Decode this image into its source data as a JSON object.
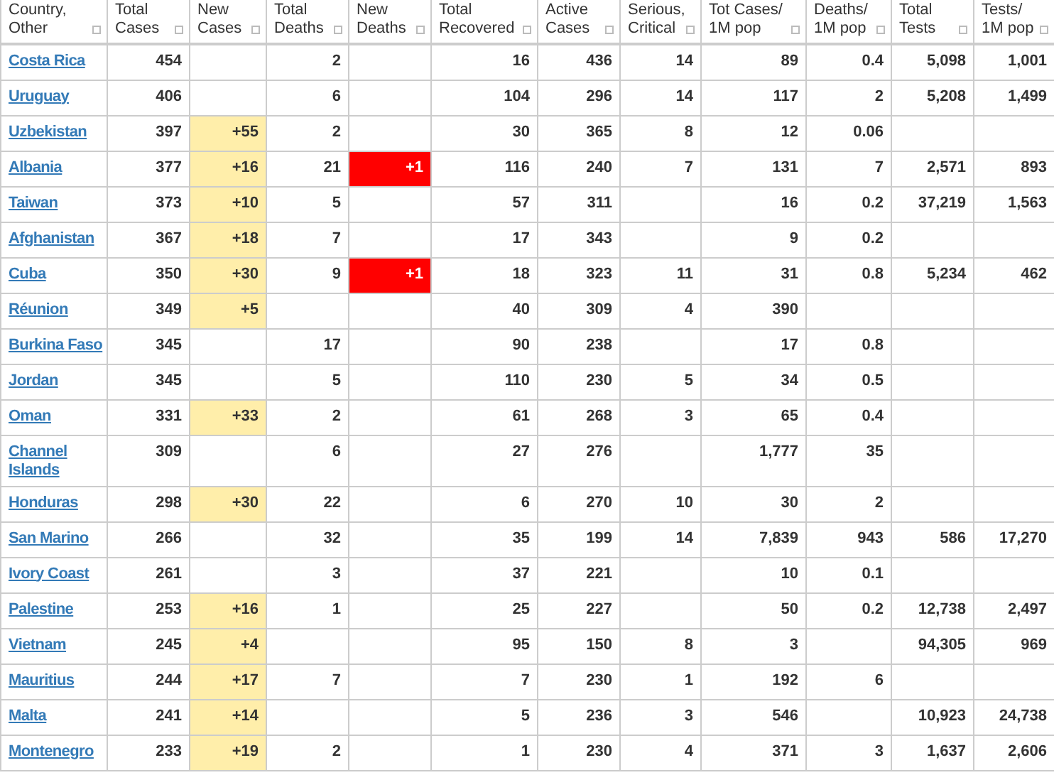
{
  "table": {
    "columns": [
      {
        "label": "Country, Other",
        "kind": "country"
      },
      {
        "label": "Total Cases",
        "kind": "number"
      },
      {
        "label": "New Cases",
        "kind": "new_cases"
      },
      {
        "label": "Total Deaths",
        "kind": "number"
      },
      {
        "label": "New Deaths",
        "kind": "new_deaths"
      },
      {
        "label": "Total Recovered",
        "kind": "number"
      },
      {
        "label": "Active Cases",
        "kind": "number"
      },
      {
        "label": "Serious, Critical",
        "kind": "number"
      },
      {
        "label": "Tot Cases/ 1M pop",
        "kind": "number"
      },
      {
        "label": "Deaths/ 1M pop",
        "kind": "number"
      },
      {
        "label": "Total Tests",
        "kind": "number"
      },
      {
        "label": "Tests/ 1M pop",
        "kind": "number"
      }
    ],
    "rows": [
      [
        "Costa Rica",
        "454",
        null,
        "2",
        null,
        "16",
        "436",
        "14",
        "89",
        "0.4",
        "5,098",
        "1,001"
      ],
      [
        "Uruguay",
        "406",
        null,
        "6",
        null,
        "104",
        "296",
        "14",
        "117",
        "2",
        "5,208",
        "1,499"
      ],
      [
        "Uzbekistan",
        "397",
        "+55",
        "2",
        null,
        "30",
        "365",
        "8",
        "12",
        "0.06",
        null,
        null
      ],
      [
        "Albania",
        "377",
        "+16",
        "21",
        "+1",
        "116",
        "240",
        "7",
        "131",
        "7",
        "2,571",
        "893"
      ],
      [
        "Taiwan",
        "373",
        "+10",
        "5",
        null,
        "57",
        "311",
        null,
        "16",
        "0.2",
        "37,219",
        "1,563"
      ],
      [
        "Afghanistan",
        "367",
        "+18",
        "7",
        null,
        "17",
        "343",
        null,
        "9",
        "0.2",
        null,
        null
      ],
      [
        "Cuba",
        "350",
        "+30",
        "9",
        "+1",
        "18",
        "323",
        "11",
        "31",
        "0.8",
        "5,234",
        "462"
      ],
      [
        "Réunion",
        "349",
        "+5",
        null,
        null,
        "40",
        "309",
        "4",
        "390",
        null,
        null,
        null
      ],
      [
        "Burkina Faso",
        "345",
        null,
        "17",
        null,
        "90",
        "238",
        null,
        "17",
        "0.8",
        null,
        null
      ],
      [
        "Jordan",
        "345",
        null,
        "5",
        null,
        "110",
        "230",
        "5",
        "34",
        "0.5",
        null,
        null
      ],
      [
        "Oman",
        "331",
        "+33",
        "2",
        null,
        "61",
        "268",
        "3",
        "65",
        "0.4",
        null,
        null
      ],
      [
        "Channel Islands",
        "309",
        null,
        "6",
        null,
        "27",
        "276",
        null,
        "1,777",
        "35",
        null,
        null
      ],
      [
        "Honduras",
        "298",
        "+30",
        "22",
        null,
        "6",
        "270",
        "10",
        "30",
        "2",
        null,
        null
      ],
      [
        "San Marino",
        "266",
        null,
        "32",
        null,
        "35",
        "199",
        "14",
        "7,839",
        "943",
        "586",
        "17,270"
      ],
      [
        "Ivory Coast",
        "261",
        null,
        "3",
        null,
        "37",
        "221",
        null,
        "10",
        "0.1",
        null,
        null
      ],
      [
        "Palestine",
        "253",
        "+16",
        "1",
        null,
        "25",
        "227",
        null,
        "50",
        "0.2",
        "12,738",
        "2,497"
      ],
      [
        "Vietnam",
        "245",
        "+4",
        null,
        null,
        "95",
        "150",
        "8",
        "3",
        null,
        "94,305",
        "969"
      ],
      [
        "Mauritius",
        "244",
        "+17",
        "7",
        null,
        "7",
        "230",
        "1",
        "192",
        "6",
        null,
        null
      ],
      [
        "Malta",
        "241",
        "+14",
        null,
        null,
        "5",
        "236",
        "3",
        "546",
        null,
        "10,923",
        "24,738"
      ],
      [
        "Montenegro",
        "233",
        "+19",
        "2",
        null,
        "1",
        "230",
        "4",
        "371",
        "3",
        "1,637",
        "2,606"
      ]
    ]
  }
}
